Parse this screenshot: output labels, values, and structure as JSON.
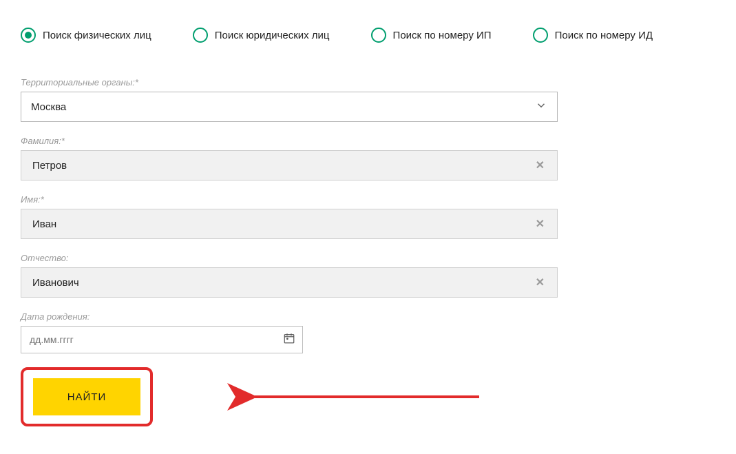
{
  "tabs": [
    {
      "label": "Поиск физических лиц",
      "selected": true
    },
    {
      "label": "Поиск юридических лиц",
      "selected": false
    },
    {
      "label": "Поиск по номеру ИП",
      "selected": false
    },
    {
      "label": "Поиск по номеру ИД",
      "selected": false
    }
  ],
  "fields": {
    "region": {
      "label": "Территориальные органы:*",
      "value": "Москва"
    },
    "lastname": {
      "label": "Фамилия:*",
      "value": "Петров"
    },
    "firstname": {
      "label": "Имя:*",
      "value": "Иван"
    },
    "patronymic": {
      "label": "Отчество:",
      "value": "Иванович"
    },
    "birthdate": {
      "label": "Дата рождения:",
      "placeholder": "дд.мм.гггг",
      "value": ""
    }
  },
  "submit": {
    "label": "НАЙТИ"
  },
  "colors": {
    "accent": "#009e6e",
    "button": "#ffd400",
    "highlight": "#e22b2b"
  }
}
